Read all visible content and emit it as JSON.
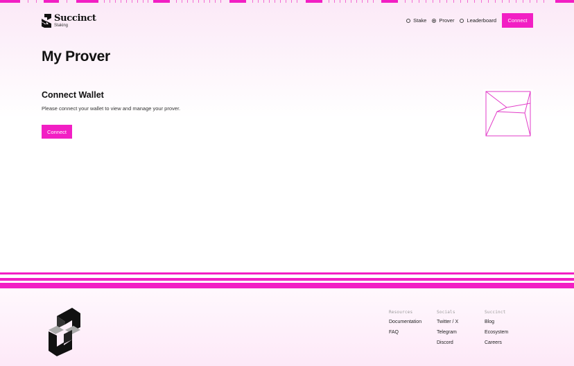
{
  "brand": {
    "name": "Succinct",
    "subtitle": "Staking"
  },
  "nav": {
    "items": [
      {
        "label": "Stake",
        "selected": false
      },
      {
        "label": "Prover",
        "selected": true
      },
      {
        "label": "Leaderboard",
        "selected": false
      }
    ],
    "connect_label": "Connect"
  },
  "page": {
    "title": "My Prover"
  },
  "wallet_card": {
    "title": "Connect Wallet",
    "description": "Please connect your wallet to view and manage your prover.",
    "connect_label": "Connect"
  },
  "footer": {
    "columns": [
      {
        "heading": "Resources",
        "links": [
          "Documentation",
          "FAQ"
        ]
      },
      {
        "heading": "Socials",
        "links": [
          "Twitter / X",
          "Telegram",
          "Discord"
        ]
      },
      {
        "heading": "Succinct",
        "links": [
          "Blog",
          "Ecosystem",
          "Careers"
        ]
      }
    ]
  },
  "colors": {
    "accent": "#f21fc4",
    "text": "#111111",
    "muted": "#999999"
  }
}
